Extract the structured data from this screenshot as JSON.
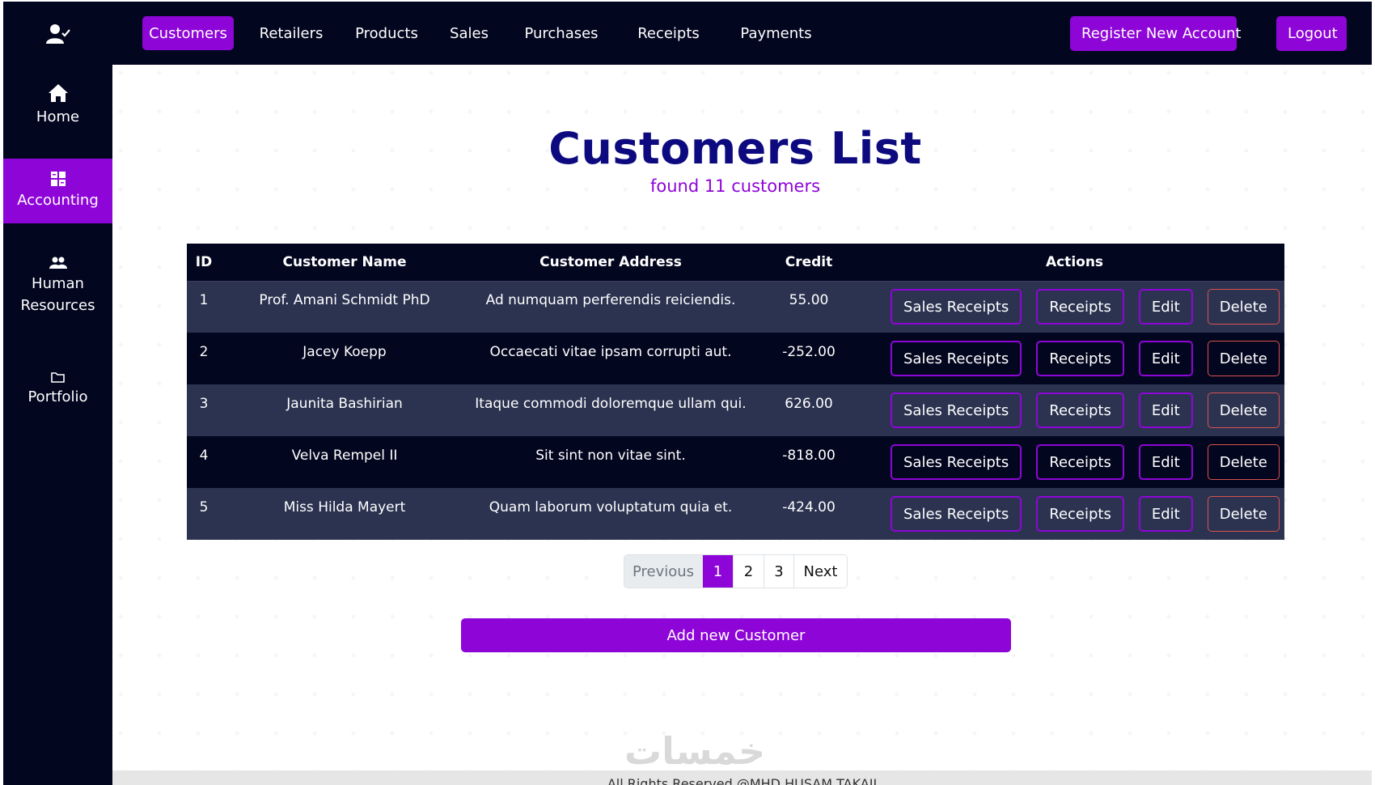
{
  "sidebar": {
    "items": [
      {
        "label": "Home",
        "icon": "home-icon"
      },
      {
        "label": "Accounting",
        "icon": "accounting-icon",
        "active": true
      },
      {
        "label": "Human Resources",
        "icon": "users-icon"
      },
      {
        "label": "Portfolio",
        "icon": "folder-icon"
      }
    ]
  },
  "nav": {
    "links": [
      "Customers",
      "Retailers",
      "Products",
      "Sales",
      "Purchases",
      "Receipts",
      "Payments"
    ],
    "register": "Register New Account",
    "logout": "Logout"
  },
  "page": {
    "title": "Customers List",
    "subtitle": "found 11 customers"
  },
  "table": {
    "headers": [
      "ID",
      "Customer Name",
      "Customer Address",
      "Credit",
      "Actions"
    ],
    "rows": [
      {
        "id": "1",
        "name": "Prof. Amani Schmidt PhD",
        "address": "Ad numquam perferendis reiciendis.",
        "credit": "55.00"
      },
      {
        "id": "2",
        "name": "Jacey Koepp",
        "address": "Occaecati vitae ipsam corrupti aut.",
        "credit": "-252.00"
      },
      {
        "id": "3",
        "name": "Jaunita Bashirian",
        "address": "Itaque commodi doloremque ullam qui.",
        "credit": "626.00"
      },
      {
        "id": "4",
        "name": "Velva Rempel II",
        "address": "Sit sint non vitae sint.",
        "credit": "-818.00"
      },
      {
        "id": "5",
        "name": "Miss Hilda Mayert",
        "address": "Quam laborum voluptatum quia et.",
        "credit": "-424.00"
      }
    ],
    "actions": {
      "sales_receipts": "Sales Receipts",
      "receipts": "Receipts",
      "edit": "Edit",
      "delete": "Delete"
    }
  },
  "pagination": {
    "previous": "Previous",
    "pages": [
      "1",
      "2",
      "3"
    ],
    "next": "Next"
  },
  "add_button": "Add new Customer",
  "watermark": "خمسات",
  "footer": "All Rights Reserved @MHD HUSAM TAKAII",
  "colors": {
    "dark": "#03061f",
    "accent": "#8e05d8",
    "title": "#0d0a80",
    "row_alt": "#2b3350",
    "danger": "#d9534f"
  }
}
